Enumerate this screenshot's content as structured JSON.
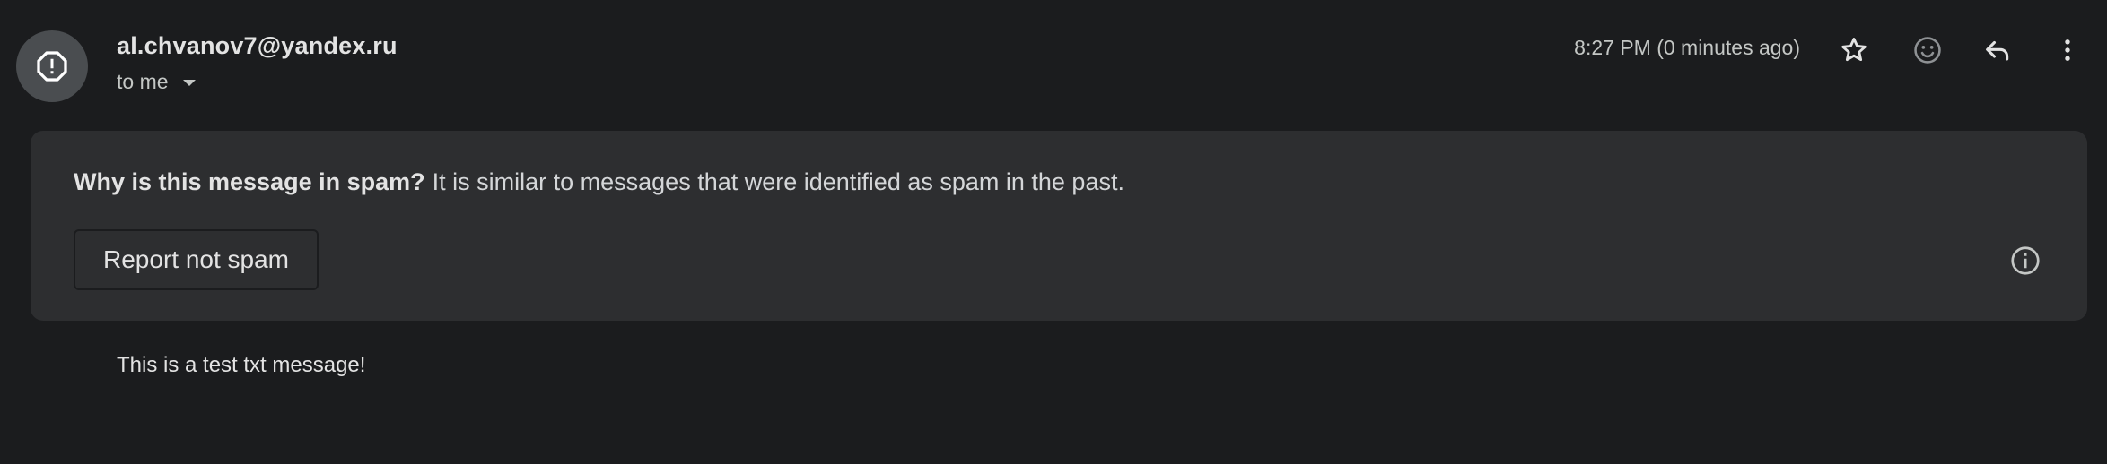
{
  "message": {
    "sender": "al.chvanov7@yandex.ru",
    "recipient_label": "to me",
    "timestamp": "8:27 PM (0 minutes ago)",
    "body": "This is a test txt message!"
  },
  "spam_banner": {
    "question": "Why is this message in spam?",
    "reason": "It is similar to messages that were identified as spam in the past.",
    "report_button_label": "Report not spam"
  },
  "icons": {
    "avatar": "spam-warning-icon",
    "star": "star-icon",
    "emoji": "emoji-icon",
    "reply": "reply-icon",
    "more": "more-vert-icon",
    "info": "info-icon",
    "recipient_details": "caret-down-icon"
  },
  "colors": {
    "background": "#1b1c1e",
    "banner": "#2d2e30",
    "avatar": "#4a4d50",
    "text": "#e3e3e3",
    "secondary_text": "#c4c7c5"
  }
}
